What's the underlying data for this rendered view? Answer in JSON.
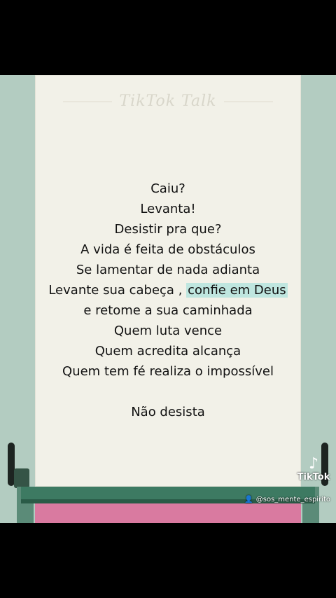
{
  "video": {
    "watermark": "TikTok Talk",
    "lines": [
      "Caiu?",
      "Levanta!",
      "Desistir pra que?",
      "A vida é feita de obstáculos",
      "Se lamentar de nada  adianta"
    ],
    "line6_before": "Levante sua cabeça , ",
    "line6_highlight": "confie em Deus",
    "lines_after": [
      "e retome a sua  caminhada",
      "Quem luta vence",
      "Quem acredita alcança",
      "Quem tem fé realiza o impossível"
    ],
    "closing": "Não desista"
  },
  "tiktok": {
    "logo_text": "TikTok",
    "handle": "@sos_mente_espirito",
    "icon": "tiktok-logo-icon"
  },
  "colors": {
    "highlight": "#bfe6df",
    "paper": "#f2f1e8",
    "background": "#000000"
  }
}
